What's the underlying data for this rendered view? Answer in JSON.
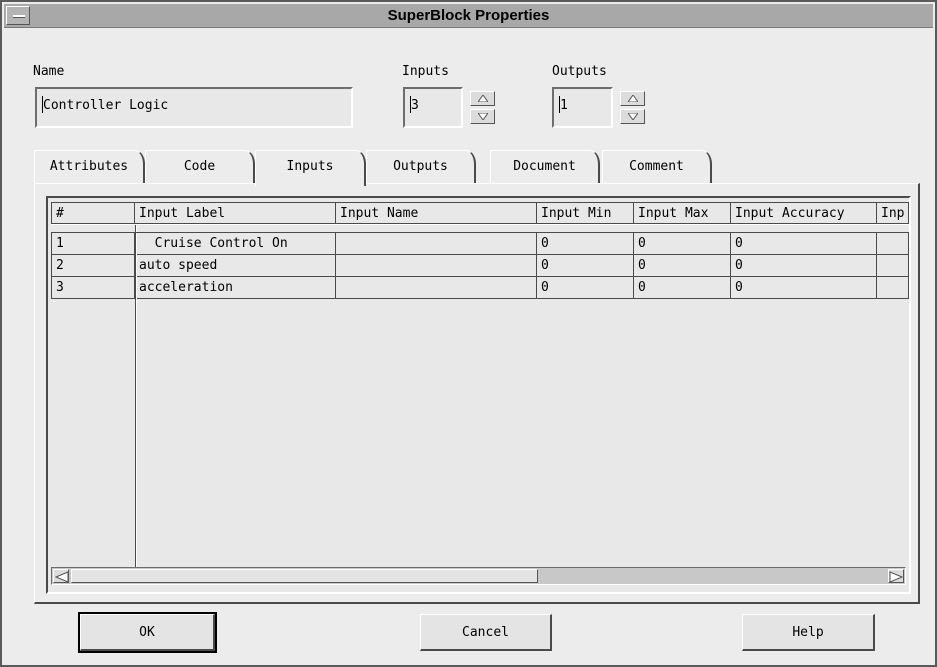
{
  "window": {
    "title": "SuperBlock Properties"
  },
  "name_field": {
    "label": "Name",
    "value": "Controller Logic"
  },
  "inputs_field": {
    "label": "Inputs",
    "value": "3"
  },
  "outputs_field": {
    "label": "Outputs",
    "value": "1"
  },
  "tabs": [
    {
      "label": "Attributes"
    },
    {
      "label": "Code"
    },
    {
      "label": "Inputs",
      "active": true
    },
    {
      "label": "Outputs"
    },
    {
      "label": "Document"
    },
    {
      "label": "Comment"
    }
  ],
  "table": {
    "columns": [
      "#",
      "Input Label",
      "Input Name",
      "Input Min",
      "Input Max",
      "Input Accuracy",
      "Inp"
    ],
    "rows": [
      [
        "1",
        "  Cruise Control On",
        "",
        "0",
        "0",
        "0",
        ""
      ],
      [
        "2",
        "auto speed",
        "",
        "0",
        "0",
        "0",
        ""
      ],
      [
        "3",
        "acceleration",
        "",
        "0",
        "0",
        "0",
        ""
      ]
    ]
  },
  "buttons": {
    "ok": "OK",
    "cancel": "Cancel",
    "help": "Help"
  }
}
